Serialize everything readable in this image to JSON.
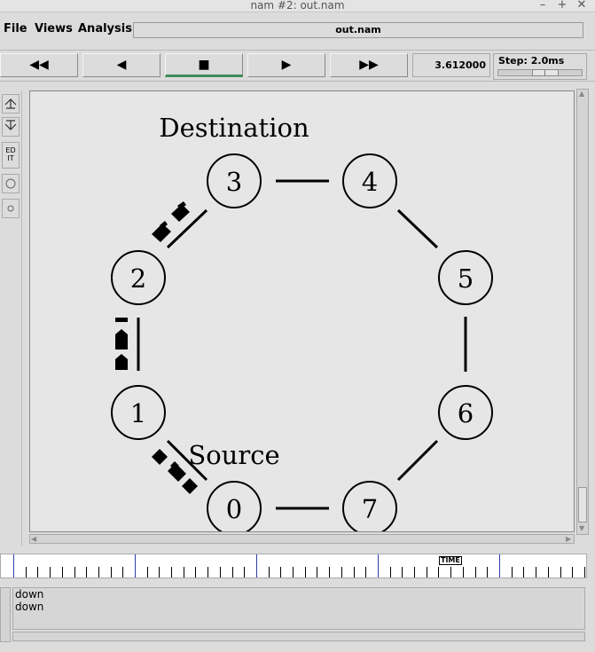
{
  "window": {
    "title": "nam #2: out.nam"
  },
  "menu": {
    "file": "File",
    "views": "Views",
    "analysis": "Analysis"
  },
  "filename": "out.nam",
  "controls": {
    "rewind": "◀◀",
    "back": "◀",
    "stop": "■",
    "play": "▶",
    "forward": "▶▶",
    "time": "3.612000",
    "step_label": "Step: 2.0ms"
  },
  "tools": {
    "edit_label": "ED IT"
  },
  "annotations": {
    "destination": "Destination",
    "source": "Source"
  },
  "nodes": [
    {
      "id": "0"
    },
    {
      "id": "1"
    },
    {
      "id": "2"
    },
    {
      "id": "3"
    },
    {
      "id": "4"
    },
    {
      "id": "5"
    },
    {
      "id": "6"
    },
    {
      "id": "7"
    }
  ],
  "timeline": {
    "label": "TIME"
  },
  "log": {
    "lines": [
      "down",
      "down"
    ]
  }
}
